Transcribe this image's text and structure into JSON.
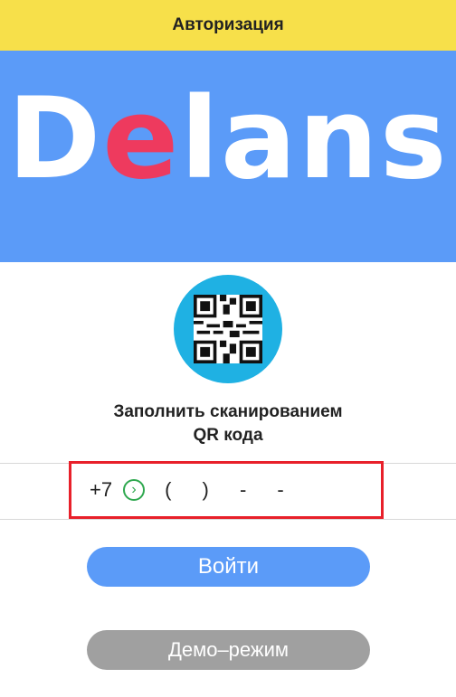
{
  "header": {
    "title": "Авторизация"
  },
  "banner": {
    "logo_prefix": "D",
    "logo_accent": "e",
    "logo_suffix": "lans"
  },
  "qr": {
    "icon": "qr-code-icon",
    "label_line1": "Заполнить сканированием",
    "label_line2": "QR кода"
  },
  "phone": {
    "prefix": "+7",
    "selector_icon": "chevron-right-circle-icon",
    "mask": "( ) - -"
  },
  "buttons": {
    "login": "Войти",
    "demo": "Демо–режим"
  },
  "colors": {
    "header_bg": "#f7e04a",
    "banner_bg": "#5b9bf8",
    "logo_accent": "#ee3a5e",
    "qr_circle": "#1fb1e3",
    "highlight_border": "#e8202a",
    "selector_green": "#2fa84f",
    "login_button": "#5b9bf8",
    "demo_button": "#a0a0a0"
  }
}
